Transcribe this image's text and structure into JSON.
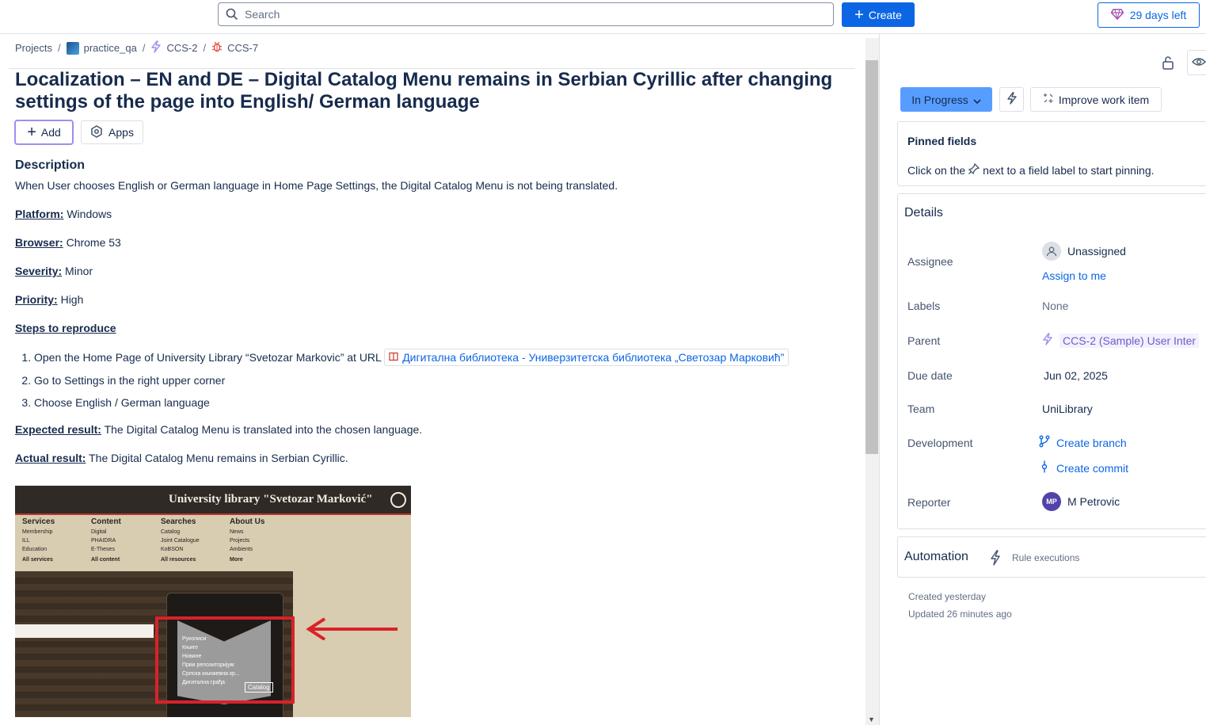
{
  "topbar": {
    "search_placeholder": "Search",
    "create_label": "Create",
    "trial_label": "29 days left"
  },
  "breadcrumbs": {
    "projects": "Projects",
    "project": "practice_qa",
    "parent": "CCS-2",
    "issue": "CCS-7"
  },
  "issue": {
    "title": "Localization – EN and DE – Digital Catalog Menu remains in Serbian Cyrillic after changing settings of the page into English/ German language",
    "add_label": "Add",
    "apps_label": "Apps"
  },
  "description": {
    "heading": "Description",
    "intro": "When User chooses English or German language in Home Page Settings, the Digital Catalog Menu is not being translated.",
    "platform_label": "Platform:",
    "platform_value": " Windows",
    "browser_label": "Browser:",
    "browser_value": " Chrome 53",
    "severity_label": "Severity:",
    "severity_value": " Minor",
    "priority_label": "Priority:",
    "priority_value": " High",
    "steps_label": "Steps to reproduce",
    "step1_text": "Open the Home Page of University Library “Svetozar Markovic” at URL ",
    "step1_link": "Дигитална библиотека - Универзитетска библиотека „Светозар Марковић”",
    "step2": "Go to Settings in the right upper corner",
    "step3": "Choose English / German language",
    "expected_label": "Expected result:",
    "expected_value": " The Digital Catalog Menu is translated into the chosen language.",
    "actual_label": "Actual result:",
    "actual_value": " The Digital Catalog Menu remains in Serbian Cyrillic."
  },
  "screenshot": {
    "header_title": "University library \"Svetozar Marković\"",
    "menus": [
      {
        "heading": "Services",
        "items": [
          "Membership",
          "ILL",
          "Education"
        ],
        "all": "All services"
      },
      {
        "heading": "Content",
        "items": [
          "Digital",
          "PHAIDRA",
          "E-Theses"
        ],
        "all": "All content"
      },
      {
        "heading": "Searches",
        "items": [
          "Catalog",
          "Joint Catalogue",
          "KoBSON"
        ],
        "all": "All resources"
      },
      {
        "heading": "About Us",
        "items": [
          "News",
          "Projects",
          "Ambients"
        ],
        "all": "More"
      }
    ],
    "dropdown_items": [
      "Рукописи",
      "Књиге",
      "Новине",
      "Први репозиторијум",
      "Српска књижевна кр...",
      "Дигитална грађа"
    ],
    "catalog_label": "Catalog"
  },
  "status": {
    "label": "In Progress",
    "improve_label": "Improve work item"
  },
  "pinned": {
    "heading": "Pinned fields",
    "hint_before": "Click on the",
    "hint_after": "next to a field label to start pinning."
  },
  "details": {
    "heading": "Details",
    "assignee_label": "Assignee",
    "assignee_value": "Unassigned",
    "assign_to_me": "Assign to me",
    "labels_label": "Labels",
    "labels_value": "None",
    "parent_label": "Parent",
    "parent_value": "CCS-2 (Sample) User Inter",
    "due_label": "Due date",
    "due_value": "Jun 02, 2025",
    "team_label": "Team",
    "team_value": "UniLibrary",
    "dev_label": "Development",
    "create_branch": "Create branch",
    "create_commit": "Create commit",
    "reporter_label": "Reporter",
    "reporter_initials": "MP",
    "reporter_value": "M Petrovic"
  },
  "automation": {
    "heading": "Automation",
    "rule_executions": "Rule executions"
  },
  "meta": {
    "created": "Created yesterday",
    "updated": "Updated 26 minutes ago"
  },
  "colors": {
    "primary": "#0c66e4",
    "status": "#579dff",
    "purple": "#9f8fef",
    "bug_red": "#e2483d"
  }
}
